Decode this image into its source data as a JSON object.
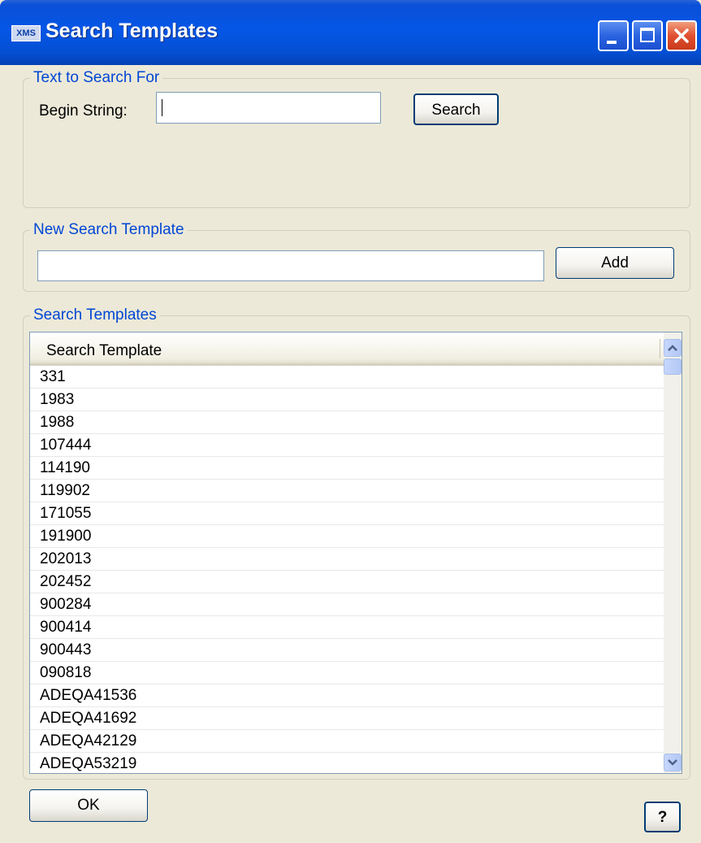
{
  "window": {
    "icon_text": "XMS",
    "title": "Search Templates"
  },
  "search_group": {
    "label": "Text to Search For",
    "begin_label": "Begin String:",
    "begin_value": "",
    "search_button": "Search"
  },
  "new_group": {
    "label": "New Search Template",
    "input_value": "",
    "add_button": "Add"
  },
  "templates_group": {
    "label": "Search Templates",
    "column_header": "Search Template",
    "rows": [
      "331",
      "1983",
      "1988",
      "107444",
      "114190",
      "119902",
      "171055",
      "191900",
      "202013",
      "202452",
      "900284",
      "900414",
      "900443",
      "090818",
      "ADEQA41536",
      "ADEQA41692",
      "ADEQA42129",
      "ADEQA53219"
    ]
  },
  "footer": {
    "ok_button": "OK",
    "help_button": "?"
  }
}
